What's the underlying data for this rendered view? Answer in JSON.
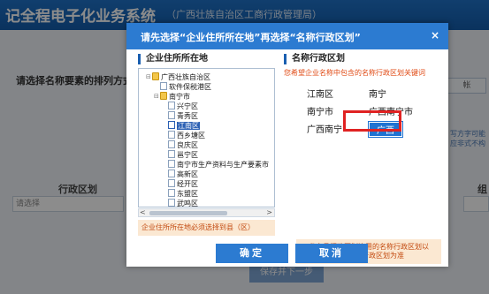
{
  "background": {
    "header_title": "记全程电子化业务系统",
    "header_subtitle": "（广西壮族自治区工商行政管理局）",
    "prompt": "请选择名称要素的排列方式：",
    "right_button": "帐",
    "right_hint": "写方字可能应非式不构",
    "column_left": "行政区划",
    "column_right": "组",
    "input_placeholder": "请选择",
    "next_button": "保存并下一步"
  },
  "dialog": {
    "title": "请先选择“企业住所所在地”再选择“名称行政区划”",
    "close_icon": "×",
    "left_section_title": "企业住所所在地",
    "tree": [
      {
        "label": "广西壮族自治区",
        "depth": 0,
        "icon": "folder",
        "toggle": "⊟",
        "selected": false
      },
      {
        "label": "软件保税港区",
        "depth": 1,
        "icon": "doc",
        "toggle": "",
        "selected": false
      },
      {
        "label": "南宁市",
        "depth": 1,
        "icon": "folder",
        "toggle": "⊟",
        "selected": false
      },
      {
        "label": "兴宁区",
        "depth": 2,
        "icon": "doc",
        "toggle": "",
        "selected": false
      },
      {
        "label": "青秀区",
        "depth": 2,
        "icon": "doc",
        "toggle": "",
        "selected": false
      },
      {
        "label": "江南区",
        "depth": 2,
        "icon": "doc",
        "toggle": "",
        "selected": true
      },
      {
        "label": "西乡塘区",
        "depth": 2,
        "icon": "doc",
        "toggle": "",
        "selected": false
      },
      {
        "label": "良庆区",
        "depth": 2,
        "icon": "doc",
        "toggle": "",
        "selected": false
      },
      {
        "label": "邕宁区",
        "depth": 2,
        "icon": "doc",
        "toggle": "",
        "selected": false
      },
      {
        "label": "南宁市生产资料与生产要素市",
        "depth": 2,
        "icon": "doc",
        "toggle": "",
        "selected": false
      },
      {
        "label": "高新区",
        "depth": 2,
        "icon": "doc",
        "toggle": "",
        "selected": false
      },
      {
        "label": "经开区",
        "depth": 2,
        "icon": "doc",
        "toggle": "",
        "selected": false
      },
      {
        "label": "东盟区",
        "depth": 2,
        "icon": "doc",
        "toggle": "",
        "selected": false
      },
      {
        "label": "武鸣区",
        "depth": 2,
        "icon": "doc",
        "toggle": "",
        "selected": false
      }
    ],
    "scroll_left": "<",
    "scroll_right": ">",
    "left_note": "企业住所所在地必须选择到县（区）",
    "right_section_title": "名称行政区划",
    "right_subtitle": "您希望企业名称中包含的名称行政区划关键词",
    "names": [
      "江南区",
      "南宁",
      "南宁市",
      "广西南宁市",
      "广西南宁",
      "广西"
    ],
    "selected_name": "广西",
    "right_note_line1": "省市县行政区划连用的名称行政区划以",
    "right_note_line2": "最高级别行政区划为准",
    "ok_button": "确定",
    "cancel_button": "取消"
  }
}
